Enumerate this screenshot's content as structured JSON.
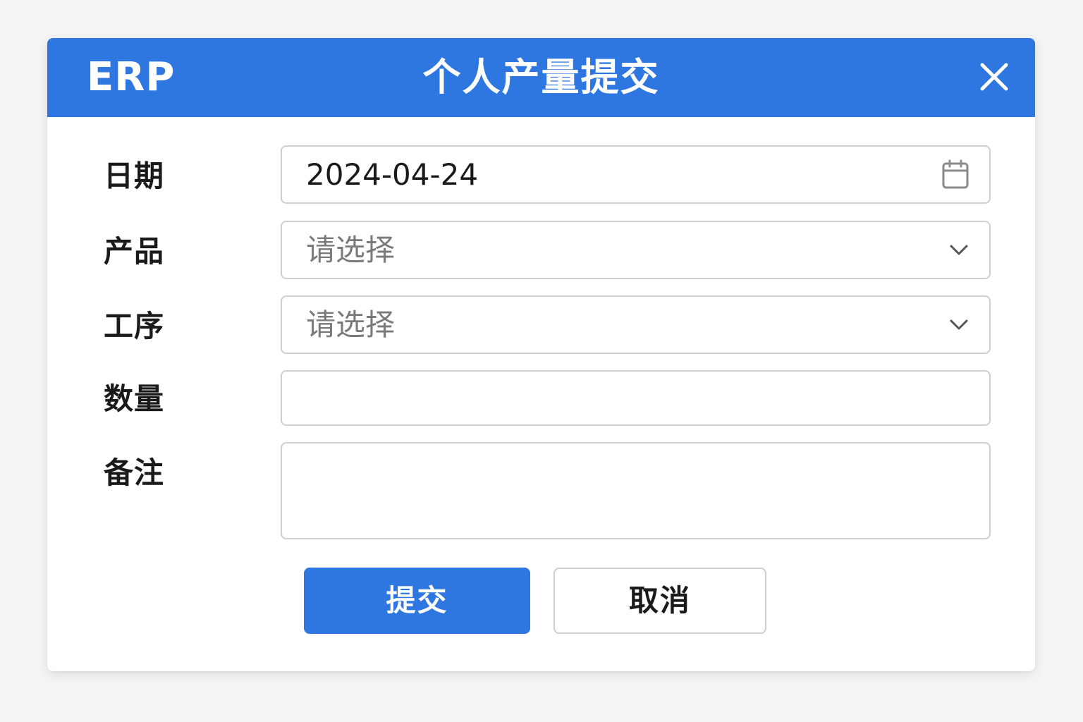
{
  "header": {
    "brand": "ERP",
    "title": "个人产量提交",
    "close_icon": "close-icon"
  },
  "form": {
    "date": {
      "label": "日期",
      "value": "2024-04-24",
      "icon": "calendar-icon"
    },
    "product": {
      "label": "产品",
      "placeholder": "请选择",
      "icon": "chevron-down-icon"
    },
    "process": {
      "label": "工序",
      "placeholder": "请选择",
      "icon": "chevron-down-icon"
    },
    "quantity": {
      "label": "数量",
      "value": ""
    },
    "remark": {
      "label": "备注",
      "value": ""
    }
  },
  "actions": {
    "submit_label": "提交",
    "cancel_label": "取消"
  },
  "colors": {
    "accent": "#2f77e0",
    "border": "#cfcfcf",
    "page_bg": "#f5f5f5"
  }
}
